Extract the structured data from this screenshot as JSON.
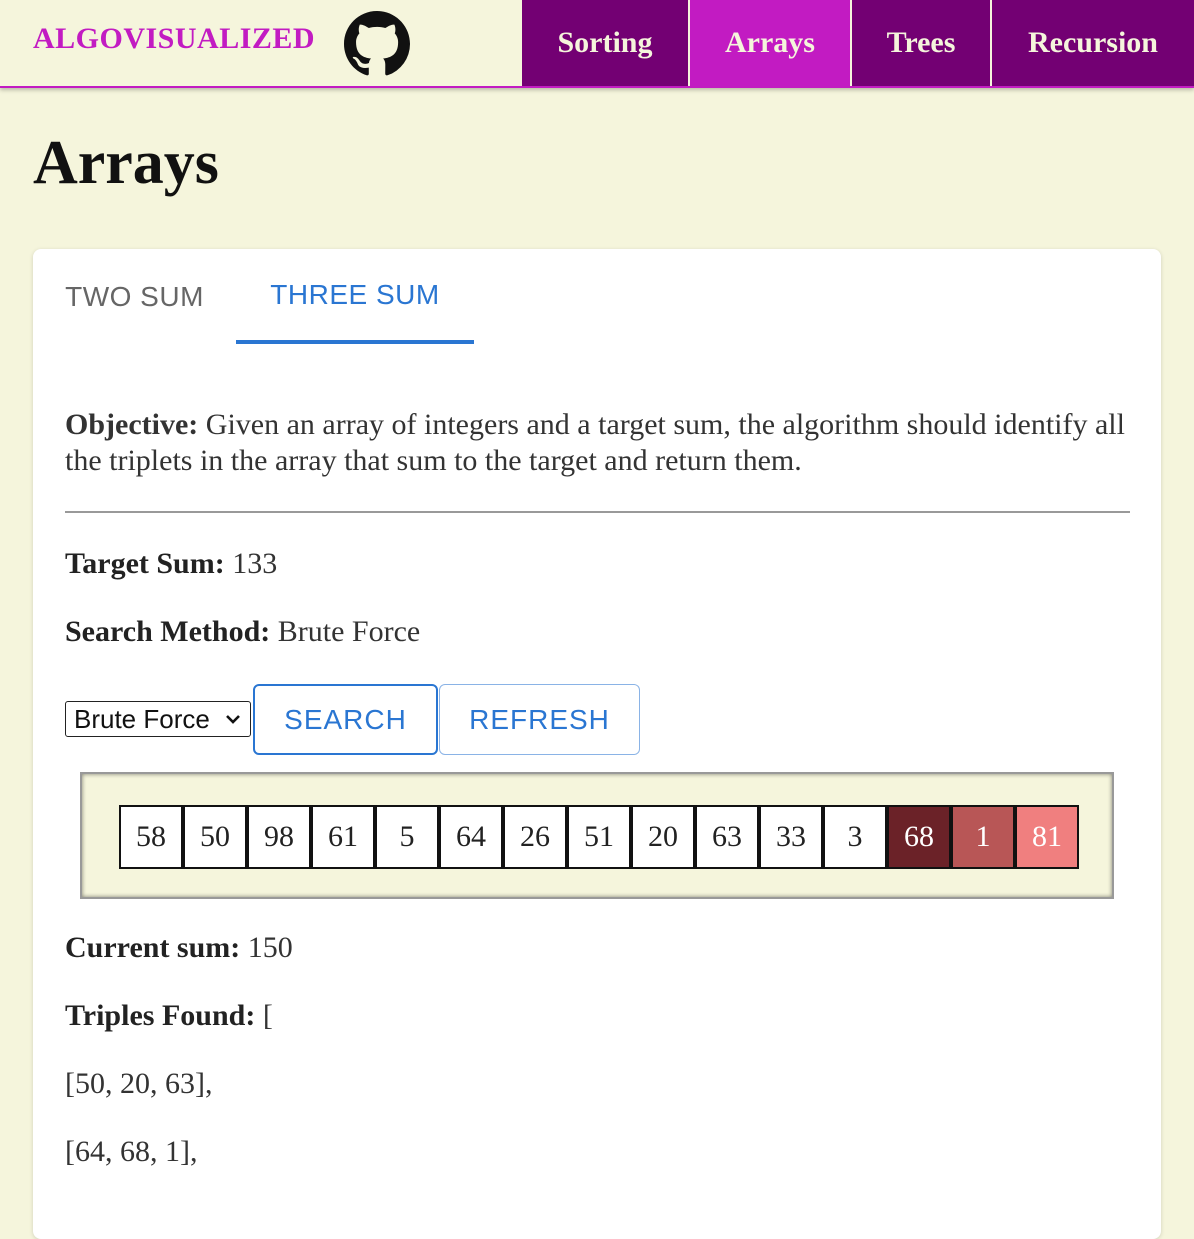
{
  "header": {
    "brand": "ALGOVISUALIZED",
    "github_icon": "github-icon",
    "nav": [
      {
        "label": "Sorting",
        "active": false
      },
      {
        "label": "Arrays",
        "active": true
      },
      {
        "label": "Trees",
        "active": false
      },
      {
        "label": "Recursion",
        "active": false
      }
    ],
    "colors": {
      "brand": "#c21bc2",
      "nav_bg": "#730073",
      "nav_active": "#c21bc2",
      "page_bg": "#f5f5dc"
    }
  },
  "page_title": "Arrays",
  "tabs": [
    {
      "label": "TWO SUM",
      "active": false
    },
    {
      "label": "THREE SUM",
      "active": true
    }
  ],
  "objective": {
    "label": "Objective:",
    "text": "Given an array of integers and a target sum, the algorithm should identify all the triplets in the array that sum to the target and return them."
  },
  "target_sum": {
    "label": "Target Sum:",
    "value": "133"
  },
  "search_method": {
    "label": "Search Method:",
    "value": "Brute Force"
  },
  "controls": {
    "select_value": "Brute Force",
    "search_label": "SEARCH",
    "refresh_label": "REFRESH"
  },
  "array": {
    "values": [
      "58",
      "50",
      "98",
      "61",
      "5",
      "64",
      "26",
      "51",
      "20",
      "63",
      "33",
      "3",
      "68",
      "1",
      "81"
    ],
    "highlight_colors": {
      "first": "#6b2228",
      "second": "#b85656",
      "third": "#f07f7f"
    }
  },
  "current_sum": {
    "label": "Current sum:",
    "value": "150"
  },
  "triples": {
    "label": "Triples Found:",
    "open": "[",
    "items": [
      "[50, 20, 63],",
      "[64, 68, 1],"
    ]
  }
}
